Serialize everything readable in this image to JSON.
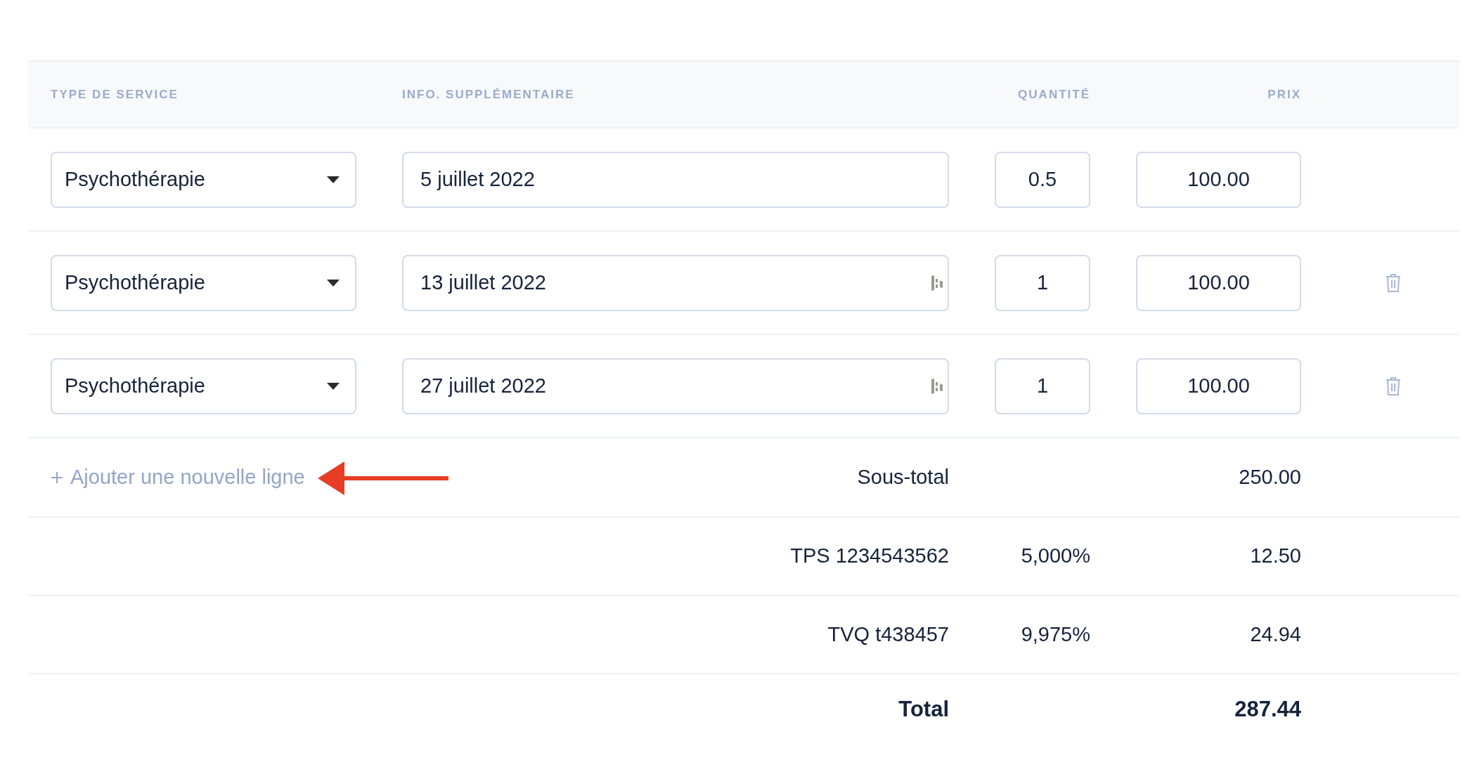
{
  "columns": [
    "TYPE DE SERVICE",
    "INFO. SUPPLÉMENTAIRE",
    "QUANTITÉ",
    "PRIX"
  ],
  "rows": [
    {
      "service": "Psychothérapie",
      "info": "5 juillet 2022",
      "info_icon": false,
      "quantity": "0.5",
      "price": "100.00",
      "deletable": false
    },
    {
      "service": "Psychothérapie",
      "info": "13 juillet 2022",
      "info_icon": true,
      "quantity": "1",
      "price": "100.00",
      "deletable": true
    },
    {
      "service": "Psychothérapie",
      "info": "27 juillet 2022",
      "info_icon": true,
      "quantity": "1",
      "price": "100.00",
      "deletable": true
    }
  ],
  "add_line": {
    "label": "Ajouter une nouvelle ligne"
  },
  "summary": [
    {
      "kind": "subtotal",
      "label": "Sous-total",
      "value": "250.00"
    },
    {
      "kind": "tax",
      "label": "TPS 1234543562",
      "rate": "5,000%",
      "value": "12.50"
    },
    {
      "kind": "tax",
      "label": "TVQ t438457",
      "rate": "9,975%",
      "value": "24.94"
    },
    {
      "kind": "total",
      "label": "Total",
      "value": "287.44"
    }
  ]
}
